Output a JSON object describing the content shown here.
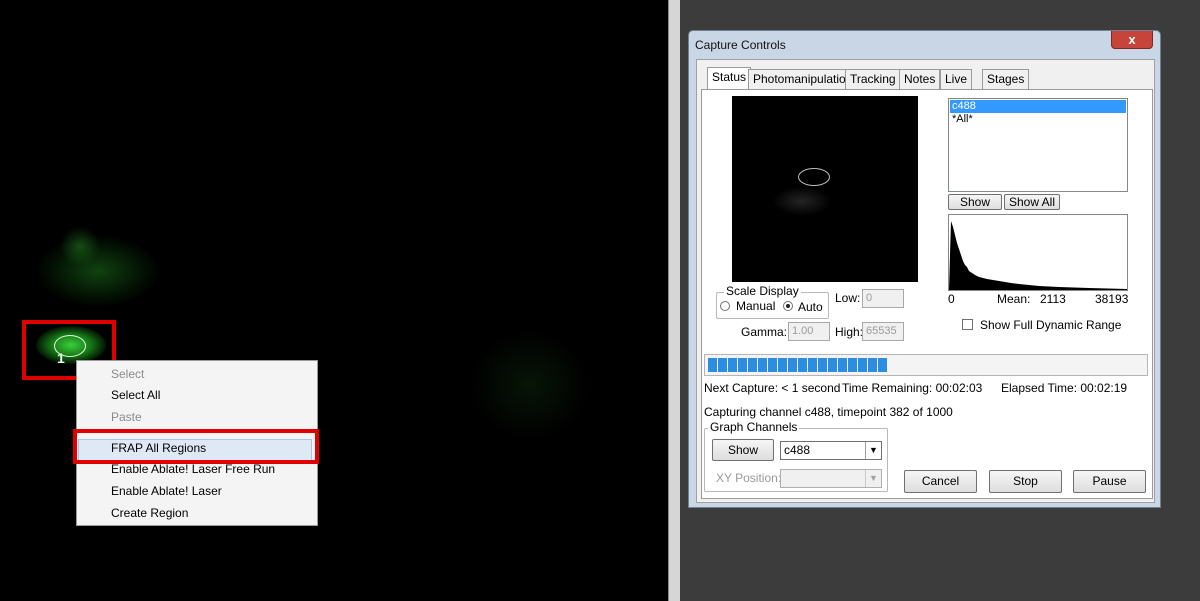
{
  "context_menu": {
    "items": [
      {
        "label": "Select",
        "disabled": true
      },
      {
        "label": "Select All",
        "disabled": false
      },
      {
        "label": "Paste",
        "disabled": true
      },
      {
        "label": "FRAP All Regions",
        "disabled": false,
        "highlighted": true
      },
      {
        "label": "Enable Ablate! Laser Free Run",
        "disabled": false
      },
      {
        "label": "Enable Ablate! Laser",
        "disabled": false
      },
      {
        "label": "Create Region",
        "disabled": false
      }
    ]
  },
  "viewer": {
    "region_number": "1",
    "highlight_color": "#e00000",
    "cell_color": "#2fd12f"
  },
  "window": {
    "title": "Capture Controls",
    "close_glyph": "x",
    "tabs": [
      "Status",
      "Photomanipulation",
      "Tracking",
      "Notes",
      "Live",
      "Stages"
    ],
    "active_tab": "Status"
  },
  "status": {
    "channels": [
      "c488",
      "*All*"
    ],
    "selected_channel": "c488",
    "show_label": "Show",
    "show_all_label": "Show All",
    "histogram": {
      "min": "0",
      "mean_label": "Mean:",
      "mean": "2113",
      "max": "38193"
    },
    "show_full_dynamic_range_label": "Show Full Dynamic Range",
    "scale_display": {
      "title": "Scale Display",
      "manual_label": "Manual",
      "auto_label": "Auto",
      "selected": "Auto",
      "low_label": "Low:",
      "low_value": "0",
      "high_label": "High:",
      "high_value": "65535",
      "gamma_label": "Gamma:",
      "gamma_value": "1.00"
    },
    "progress": {
      "completed_fraction": 0.382,
      "segments_total": 46,
      "segments_filled": 18
    },
    "next_capture": "Next Capture: < 1 second",
    "time_remaining": "Time Remaining: 00:02:03",
    "elapsed_time": "Elapsed Time: 00:02:19",
    "capturing": "Capturing channel c488, timepoint 382 of 1000",
    "graph_channels": {
      "title": "Graph Channels",
      "show_label": "Show",
      "channel_value": "c488",
      "xy_position_label": "XY Position:"
    },
    "buttons": {
      "cancel": "Cancel",
      "stop": "Stop",
      "pause": "Pause"
    }
  },
  "colors": {
    "progress": "#2d8de0",
    "selection": "#3399ff",
    "window_frame": "#c9d6e6"
  }
}
